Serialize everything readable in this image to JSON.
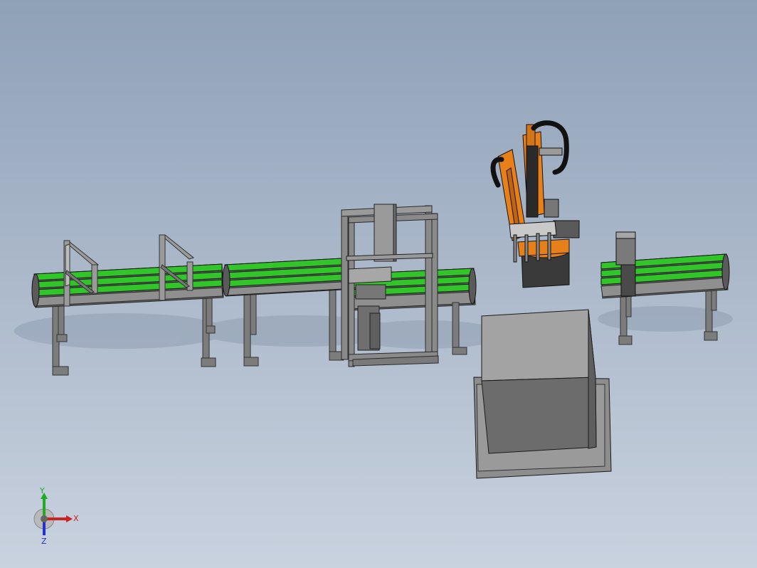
{
  "triad": {
    "x_label": "X",
    "y_label": "Y",
    "z_label": "Z"
  },
  "colors": {
    "background_top": "#8fa1b8",
    "background_bottom": "#c9d2df",
    "belt_green": "#31c52a",
    "frame_gray": "#8a8a8a",
    "robot_orange": "#e8801a",
    "axis_x": "#cc2222",
    "axis_y": "#22aa22",
    "axis_z": "#2233cc"
  },
  "scene": {
    "components": [
      "conveyor-left",
      "conveyor-middle",
      "gantry-frame",
      "robot-arm",
      "pallet-station",
      "conveyor-right"
    ]
  }
}
